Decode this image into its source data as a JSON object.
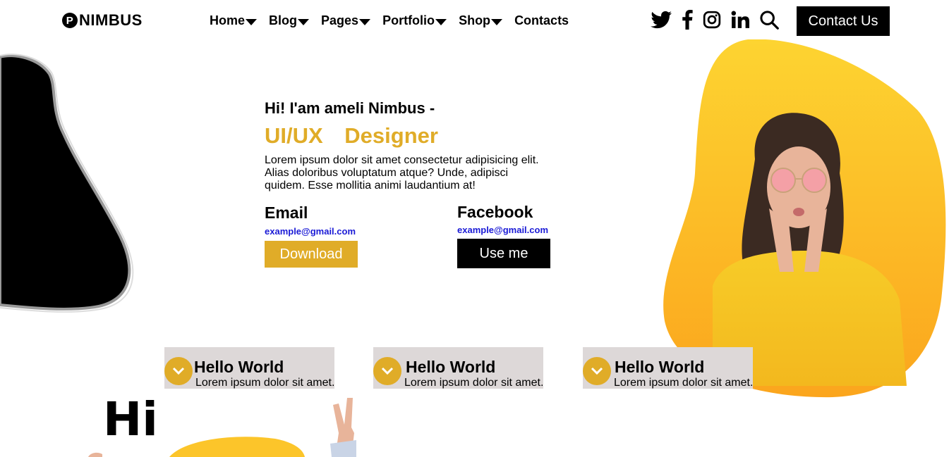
{
  "header": {
    "brand": "NIMBUS",
    "nav": [
      {
        "label": "Home",
        "has_dropdown": true
      },
      {
        "label": "Blog",
        "has_dropdown": true
      },
      {
        "label": "Pages",
        "has_dropdown": true
      },
      {
        "label": "Portfolio",
        "has_dropdown": true
      },
      {
        "label": "Shop",
        "has_dropdown": true
      },
      {
        "label": "Contacts",
        "has_dropdown": false
      }
    ],
    "social_icons": [
      "twitter-icon",
      "facebook-icon",
      "instagram-icon",
      "linkedin-icon",
      "search-icon"
    ],
    "cta_label": "Contact Us"
  },
  "hero": {
    "greeting": "Hi! I'am ameli Nimbus -",
    "role": "UI/UX Designer",
    "description": "Lorem ipsum dolor sit amet consectetur adipisicing elit. Alias doloribus voluptatum atque? Unde, adipisci quidem. Esse mollitia animi laudantium at!",
    "email": {
      "title": "Email",
      "link": "example@gmail.com",
      "button": "Download"
    },
    "facebook": {
      "title": "Facebook",
      "link": "example@gmail.com",
      "button": "Use me"
    }
  },
  "cards": [
    {
      "title": "Hello World",
      "text": "Lorem ipsum dolor sit amet."
    },
    {
      "title": "Hello World",
      "text": "Lorem ipsum dolor sit amet."
    },
    {
      "title": "Hello World",
      "text": "Lorem ipsum dolor sit amet."
    }
  ],
  "bottom": {
    "hi": "Hi"
  },
  "colors": {
    "accent": "#e0ac28",
    "card_bg": "#ddd8d8",
    "link": "#1a1ad6",
    "dark": "#000000"
  }
}
